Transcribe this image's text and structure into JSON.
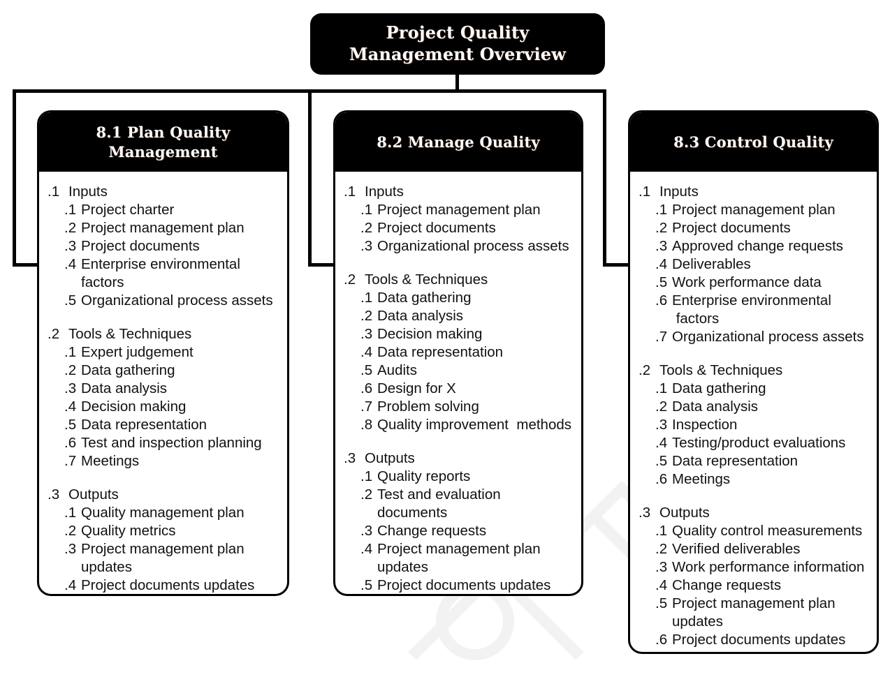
{
  "diagram": {
    "title": "Project Quality\nManagement Overview",
    "accent_color": "#000000",
    "background_color": "#ffffff",
    "text_color": "#111111",
    "header_text_color": "#ffffff"
  },
  "processes": [
    {
      "id": "8.1",
      "header": "8.1 Plan Quality\nManagement",
      "sections": [
        {
          "num": ".1",
          "label": "Inputs",
          "items": [
            {
              "num": ".1",
              "text": "Project charter"
            },
            {
              "num": ".2",
              "text": "Project management plan"
            },
            {
              "num": ".3",
              "text": "Project documents"
            },
            {
              "num": ".4",
              "text": "Enterprise environmental\nfactors"
            },
            {
              "num": ".5",
              "text": "Organizational process assets"
            }
          ]
        },
        {
          "num": ".2",
          "label": "Tools & Techniques",
          "items": [
            {
              "num": ".1",
              "text": "Expert judgement"
            },
            {
              "num": ".2",
              "text": "Data gathering"
            },
            {
              "num": ".3",
              "text": "Data analysis"
            },
            {
              "num": ".4",
              "text": "Decision making"
            },
            {
              "num": ".5",
              "text": "Data representation"
            },
            {
              "num": ".6",
              "text": "Test and inspection planning"
            },
            {
              "num": ".7",
              "text": "Meetings"
            }
          ]
        },
        {
          "num": ".3",
          "label": "Outputs",
          "items": [
            {
              "num": ".1",
              "text": "Quality management plan"
            },
            {
              "num": ".2",
              "text": "Quality metrics"
            },
            {
              "num": ".3",
              "text": "Project management plan\nupdates"
            },
            {
              "num": ".4",
              "text": "Project documents updates"
            }
          ]
        }
      ]
    },
    {
      "id": "8.2",
      "header": "8.2 Manage Quality",
      "sections": [
        {
          "num": ".1",
          "label": "Inputs",
          "items": [
            {
              "num": ".1",
              "text": "Project management plan"
            },
            {
              "num": ".2",
              "text": "Project documents"
            },
            {
              "num": ".3",
              "text": "Organizational process assets"
            }
          ]
        },
        {
          "num": ".2",
          "label": "Tools & Techniques",
          "items": [
            {
              "num": ".1",
              "text": "Data gathering"
            },
            {
              "num": ".2",
              "text": "Data analysis"
            },
            {
              "num": ".3",
              "text": "Decision making"
            },
            {
              "num": ".4",
              "text": "Data representation"
            },
            {
              "num": ".5",
              "text": "Audits"
            },
            {
              "num": ".6",
              "text": "Design for X"
            },
            {
              "num": ".7",
              "text": "Problem solving"
            },
            {
              "num": ".8",
              "text": "Quality improvement  methods"
            }
          ]
        },
        {
          "num": ".3",
          "label": "Outputs",
          "items": [
            {
              "num": ".1",
              "text": "Quality reports"
            },
            {
              "num": ".2",
              "text": "Test and evaluation\ndocuments"
            },
            {
              "num": ".3",
              "text": "Change requests"
            },
            {
              "num": ".4",
              "text": "Project management plan\nupdates"
            },
            {
              "num": ".5",
              "text": "Project documents updates"
            }
          ]
        }
      ]
    },
    {
      "id": "8.3",
      "header": "8.3 Control Quality",
      "sections": [
        {
          "num": ".1",
          "label": "Inputs",
          "items": [
            {
              "num": ".1",
              "text": "Project management plan"
            },
            {
              "num": ".2",
              "text": "Project documents"
            },
            {
              "num": ".3",
              "text": "Approved change requests"
            },
            {
              "num": ".4",
              "text": "Deliverables"
            },
            {
              "num": ".5",
              "text": "Work performance data"
            },
            {
              "num": ".6",
              "text": "Enterprise environmental\n factors"
            },
            {
              "num": ".7",
              "text": "Organizational process assets"
            }
          ]
        },
        {
          "num": ".2",
          "label": "Tools & Techniques",
          "items": [
            {
              "num": ".1",
              "text": "Data gathering"
            },
            {
              "num": ".2",
              "text": "Data analysis"
            },
            {
              "num": ".3",
              "text": "Inspection"
            },
            {
              "num": ".4",
              "text": "Testing/product evaluations"
            },
            {
              "num": ".5",
              "text": "Data representation"
            },
            {
              "num": ".6",
              "text": "Meetings"
            }
          ]
        },
        {
          "num": ".3",
          "label": "Outputs",
          "items": [
            {
              "num": ".1",
              "text": "Quality control measurements"
            },
            {
              "num": ".2",
              "text": "Verified deliverables"
            },
            {
              "num": ".3",
              "text": "Work performance information"
            },
            {
              "num": ".4",
              "text": "Change requests"
            },
            {
              "num": ".5",
              "text": "Project management plan\nupdates"
            },
            {
              "num": ".6",
              "text": "Project documents updates"
            }
          ]
        }
      ]
    }
  ]
}
